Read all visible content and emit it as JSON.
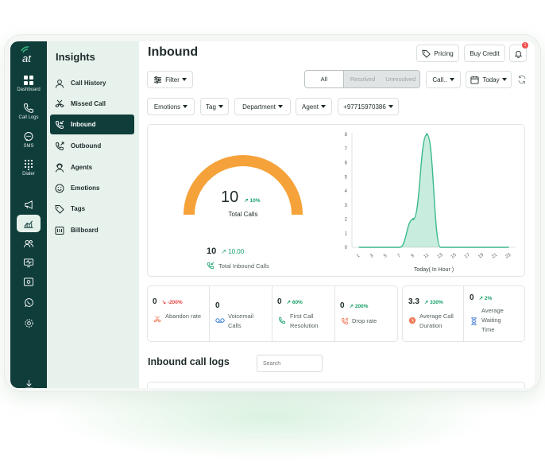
{
  "brand": {
    "logo_text": "at",
    "accent": "#0f3d3a",
    "chart_color": "#39b98a",
    "gauge_color": "#f6a23a"
  },
  "rail": {
    "items": [
      {
        "label": "Dashboard",
        "icon": "grid-icon"
      },
      {
        "label": "Call Logs",
        "icon": "phone-icon"
      },
      {
        "label": "SMS",
        "icon": "sms-icon"
      },
      {
        "label": "Dialer",
        "icon": "dialpad-icon"
      }
    ],
    "icons": [
      "megaphone-icon",
      "analytics-icon",
      "users-icon",
      "monitor-icon",
      "wallet-icon",
      "whatsapp-icon",
      "settings-icon",
      "logout-icon"
    ]
  },
  "sidebar": {
    "title": "Insights",
    "items": [
      {
        "label": "Call History",
        "icon": "user-icon"
      },
      {
        "label": "Missed Call",
        "icon": "missed-call-icon"
      },
      {
        "label": "Inbound",
        "icon": "inbound-call-icon"
      },
      {
        "label": "Outbound",
        "icon": "outbound-call-icon"
      },
      {
        "label": "Agents",
        "icon": "agent-icon"
      },
      {
        "label": "Emotions",
        "icon": "smile-icon"
      },
      {
        "label": "Tags",
        "icon": "tag-icon"
      },
      {
        "label": "Billboard",
        "icon": "billboard-icon"
      }
    ]
  },
  "header": {
    "title": "Inbound",
    "pricing": "Pricing",
    "buy_credit": "Buy Credit",
    "notification_count": "1"
  },
  "filters": {
    "filter": "Filter",
    "segments": [
      "All",
      "Resolved",
      "Unresolved"
    ],
    "call": "Call..",
    "today": "Today",
    "emotions": "Emotions",
    "tag": "Tag",
    "department": "Department",
    "agent": "Agent",
    "number": "+97715970386"
  },
  "gauge": {
    "value": "10",
    "change": "10%",
    "label": "Total Calls",
    "fill": 1.0
  },
  "inbound_total": {
    "value": "10",
    "change": "10.00",
    "label": "Total Inbound Calls"
  },
  "chart_data": {
    "type": "area",
    "xlabel": "Today( In Hour )",
    "ylabel": "",
    "ylim": [
      0,
      8
    ],
    "yticks": [
      0,
      1,
      2,
      3,
      4,
      5,
      6,
      7,
      8
    ],
    "x": [
      1,
      3,
      5,
      7,
      9,
      11,
      13,
      15,
      17,
      19,
      21,
      23
    ],
    "series": [
      {
        "values": [
          0,
          0,
          0,
          0,
          2,
          8,
          0,
          0,
          0,
          0,
          0,
          0
        ]
      }
    ]
  },
  "metrics": [
    {
      "value": "0",
      "change": "-200%",
      "dir": "down",
      "label": "Abandon rate",
      "icon": "abandon-icon"
    },
    {
      "value": "0",
      "change": "",
      "dir": "",
      "label": "Voicemail Calls",
      "icon": "voicemail-icon"
    },
    {
      "value": "0",
      "change": "60%",
      "dir": "up",
      "label": "First Call Resolution",
      "icon": "resolution-icon"
    },
    {
      "value": "0",
      "change": "200%",
      "dir": "up",
      "label": "Drop rate",
      "icon": "drop-icon"
    },
    {
      "value": "3.3",
      "change": "330%",
      "dir": "up",
      "label": "Average Call Duration",
      "icon": "duration-icon"
    },
    {
      "value": "0",
      "change": "2%",
      "dir": "up",
      "label": "Average Waiting Time",
      "icon": "hourglass-icon"
    }
  ],
  "logs": {
    "title": "Inbound call logs",
    "search_placeholder": "Search"
  }
}
